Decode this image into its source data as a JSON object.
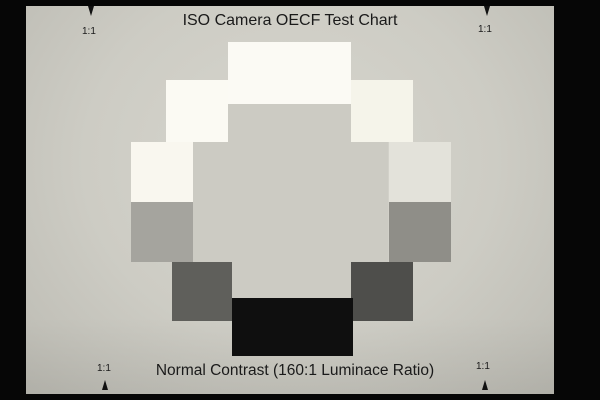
{
  "chart": {
    "title": "ISO Camera OECF Test Chart",
    "subtitle": "Normal Contrast (160:1 Luminace Ratio)",
    "corner_labels": {
      "top_left": "1:1",
      "top_right": "1:1",
      "bottom_left": "1:1",
      "bottom_right": "1:1"
    }
  },
  "colors": {
    "background_surround": "#060606",
    "chart_surface": "#d2d1c9",
    "center_field": "#cccbc3"
  },
  "patches": [
    {
      "name": "patch-top-center",
      "color": "#fbfaf4"
    },
    {
      "name": "patch-upper-right",
      "color": "#f5f4ea"
    },
    {
      "name": "patch-right-top",
      "color": "#e3e2da"
    },
    {
      "name": "patch-right-middle",
      "color": "#8f8e88"
    },
    {
      "name": "patch-lower-right",
      "color": "#4e4e4b"
    },
    {
      "name": "patch-bottom-center",
      "color": "#0f0f0f"
    },
    {
      "name": "patch-lower-left",
      "color": "#5f5f5b"
    },
    {
      "name": "patch-left-middle",
      "color": "#a5a49e"
    },
    {
      "name": "patch-left-top",
      "color": "#f9f7ef"
    },
    {
      "name": "patch-upper-left",
      "color": "#fbfaf3"
    }
  ]
}
